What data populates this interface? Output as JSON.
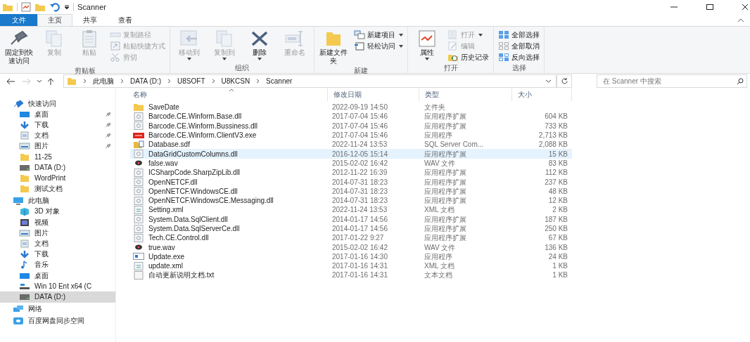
{
  "window": {
    "title": "Scanner"
  },
  "ribbon": {
    "tabs": [
      {
        "label": "文件",
        "kind": "file",
        "selected": false
      },
      {
        "label": "主页",
        "kind": "tab",
        "selected": true
      },
      {
        "label": "共享",
        "kind": "tab",
        "selected": false
      },
      {
        "label": "查看",
        "kind": "tab",
        "selected": false
      }
    ],
    "groups": [
      {
        "label": "剪贴板",
        "items": [
          {
            "label": "固定到快速访问",
            "kind": "large",
            "disabled": false,
            "dropdown": false
          },
          {
            "label": "复制",
            "kind": "large",
            "disabled": true,
            "dropdown": false
          },
          {
            "label": "粘贴",
            "kind": "large",
            "disabled": true,
            "dropdown": false
          },
          {
            "label": "复制路径",
            "kind": "small",
            "disabled": true,
            "dropdown": false
          },
          {
            "label": "粘贴快捷方式",
            "kind": "small",
            "disabled": true,
            "dropdown": false
          },
          {
            "label": "剪切",
            "kind": "small",
            "disabled": true,
            "dropdown": false
          }
        ]
      },
      {
        "label": "组织",
        "items": [
          {
            "label": "移动到",
            "kind": "large",
            "disabled": true,
            "dropdown": true
          },
          {
            "label": "复制到",
            "kind": "large",
            "disabled": true,
            "dropdown": true
          },
          {
            "label": "删除",
            "kind": "large",
            "disabled": false,
            "dropdown": true
          },
          {
            "label": "重命名",
            "kind": "large",
            "disabled": true,
            "dropdown": false
          }
        ]
      },
      {
        "label": "新建",
        "items": [
          {
            "label": "新建文件夹",
            "kind": "large",
            "disabled": false,
            "dropdown": false
          },
          {
            "label": "新建项目",
            "kind": "small",
            "disabled": false,
            "dropdown": true
          },
          {
            "label": "轻松访问",
            "kind": "small",
            "disabled": false,
            "dropdown": true
          }
        ]
      },
      {
        "label": "打开",
        "items": [
          {
            "label": "属性",
            "kind": "large",
            "disabled": false,
            "dropdown": true
          },
          {
            "label": "打开",
            "kind": "small",
            "disabled": true,
            "dropdown": true
          },
          {
            "label": "编辑",
            "kind": "small",
            "disabled": true,
            "dropdown": false
          },
          {
            "label": "历史记录",
            "kind": "small",
            "disabled": false,
            "dropdown": false
          }
        ]
      },
      {
        "label": "选择",
        "items": [
          {
            "label": "全部选择",
            "kind": "small",
            "disabled": false,
            "dropdown": false
          },
          {
            "label": "全部取消",
            "kind": "small",
            "disabled": false,
            "dropdown": false
          },
          {
            "label": "反向选择",
            "kind": "small",
            "disabled": false,
            "dropdown": false
          }
        ]
      }
    ]
  },
  "address_bar": {
    "segments": [
      "此电脑",
      "DATA (D:)",
      "U8SOFT",
      "U8KCSN",
      "Scanner"
    ],
    "forward_disabled": true
  },
  "search": {
    "placeholder": "在 Scanner 中搜索"
  },
  "sidebar": {
    "items": [
      {
        "label": "快速访问",
        "kind": "quick",
        "selected": false,
        "children": [
          {
            "label": "桌面",
            "kind": "desktop",
            "pinned": true,
            "selected": false
          },
          {
            "label": "下载",
            "kind": "download",
            "pinned": true,
            "selected": false
          },
          {
            "label": "文档",
            "kind": "documents",
            "pinned": true,
            "selected": false
          },
          {
            "label": "图片",
            "kind": "pictures",
            "pinned": true,
            "selected": false
          },
          {
            "label": "11-25",
            "kind": "folder",
            "pinned": false,
            "selected": false
          },
          {
            "label": "DATA (D:)",
            "kind": "drive",
            "pinned": false,
            "selected": false
          },
          {
            "label": "WordPrint",
            "kind": "folder",
            "pinned": false,
            "selected": false
          },
          {
            "label": "测试文档",
            "kind": "folder",
            "pinned": false,
            "selected": false
          }
        ]
      },
      {
        "label": "此电脑",
        "kind": "computer",
        "selected": false,
        "children": [
          {
            "label": "3D 对象",
            "kind": "cube",
            "pinned": false,
            "selected": false
          },
          {
            "label": "视频",
            "kind": "video",
            "pinned": false,
            "selected": false
          },
          {
            "label": "图片",
            "kind": "pictures",
            "pinned": false,
            "selected": false
          },
          {
            "label": "文档",
            "kind": "documents",
            "pinned": false,
            "selected": false
          },
          {
            "label": "下载",
            "kind": "download",
            "pinned": false,
            "selected": false
          },
          {
            "label": "音乐",
            "kind": "music",
            "pinned": false,
            "selected": false
          },
          {
            "label": "桌面",
            "kind": "desktop",
            "pinned": false,
            "selected": false
          },
          {
            "label": "Win 10 Ent x64 (C",
            "kind": "os-drive",
            "pinned": false,
            "selected": false
          },
          {
            "label": "DATA (D:)",
            "kind": "drive",
            "pinned": false,
            "selected": true
          }
        ]
      },
      {
        "label": "网络",
        "kind": "network",
        "selected": false
      },
      {
        "label": "百度网盘同步空间",
        "kind": "cloud",
        "selected": false
      }
    ]
  },
  "file_list": {
    "columns": [
      {
        "label": "名称",
        "sorted": true
      },
      {
        "label": "修改日期",
        "sorted": false
      },
      {
        "label": "类型",
        "sorted": false
      },
      {
        "label": "大小",
        "sorted": false
      }
    ],
    "rows": [
      {
        "name": "SaveDate",
        "date": "2022-09-19 14:50",
        "type": "文件夹",
        "kind": "folder",
        "selected": false
      },
      {
        "name": "Barcode.CE.Winform.Base.dll",
        "date": "2017-07-04 15:46",
        "type": "应用程序扩展",
        "size": "604 KB",
        "kind": "dll",
        "selected": false
      },
      {
        "name": "Barcode.CE.Winform.Bussiness.dll",
        "date": "2017-07-04 15:46",
        "type": "应用程序扩展",
        "size": "733 KB",
        "kind": "dll",
        "selected": false
      },
      {
        "name": "Barcode.CE.Winform.ClientV3.exe",
        "date": "2017-07-04 15:46",
        "type": "应用程序",
        "size": "2,713 KB",
        "kind": "app",
        "selected": false
      },
      {
        "name": "Database.sdf",
        "date": "2022-11-24 13:53",
        "type": "SQL Server Com...",
        "size": "2,088 KB",
        "kind": "database",
        "selected": false
      },
      {
        "name": "DataGridCustomColumns.dll",
        "date": "2016-12-05 15:14",
        "type": "应用程序扩展",
        "size": "15 KB",
        "kind": "dll",
        "selected": true
      },
      {
        "name": "false.wav",
        "date": "2015-02-02 16:42",
        "type": "WAV 文件",
        "size": "83 KB",
        "kind": "audio",
        "selected": false
      },
      {
        "name": "ICSharpCode.SharpZipLib.dll",
        "date": "2012-11-22 16:39",
        "type": "应用程序扩展",
        "size": "112 KB",
        "kind": "dll",
        "selected": false
      },
      {
        "name": "OpenNETCF.dll",
        "date": "2014-07-31 18:23",
        "type": "应用程序扩展",
        "size": "237 KB",
        "kind": "dll",
        "selected": false
      },
      {
        "name": "OpenNETCF.WindowsCE.dll",
        "date": "2014-07-31 18:23",
        "type": "应用程序扩展",
        "size": "48 KB",
        "kind": "dll",
        "selected": false
      },
      {
        "name": "OpenNETCF.WindowsCE.Messaging.dll",
        "date": "2014-07-31 18:23",
        "type": "应用程序扩展",
        "size": "12 KB",
        "kind": "dll",
        "selected": false
      },
      {
        "name": "Setting.xml",
        "date": "2022-11-24 13:53",
        "type": "XML 文档",
        "size": "2 KB",
        "kind": "xml",
        "selected": false
      },
      {
        "name": "System.Data.SqlClient.dll",
        "date": "2014-01-17 14:56",
        "type": "应用程序扩展",
        "size": "187 KB",
        "kind": "dll",
        "selected": false
      },
      {
        "name": "System.Data.SqlServerCe.dll",
        "date": "2014-01-17 14:56",
        "type": "应用程序扩展",
        "size": "250 KB",
        "kind": "dll",
        "selected": false
      },
      {
        "name": "Tech.CE.Control.dll",
        "date": "2017-01-22 9:27",
        "type": "应用程序扩展",
        "size": "67 KB",
        "kind": "dll",
        "selected": false
      },
      {
        "name": "true.wav",
        "date": "2015-02-02 16:42",
        "type": "WAV 文件",
        "size": "136 KB",
        "kind": "audio",
        "selected": false
      },
      {
        "name": "Update.exe",
        "date": "2017-01-16 14:30",
        "type": "应用程序",
        "size": "24 KB",
        "kind": "exe",
        "selected": false
      },
      {
        "name": "update.xml",
        "date": "2017-01-16 14:31",
        "type": "XML 文档",
        "size": "1 KB",
        "kind": "xml",
        "selected": false
      },
      {
        "name": "自动更新说明文档.txt",
        "date": "2017-01-16 14:31",
        "type": "文本文档",
        "size": "1 KB",
        "kind": "text",
        "selected": false
      }
    ]
  }
}
